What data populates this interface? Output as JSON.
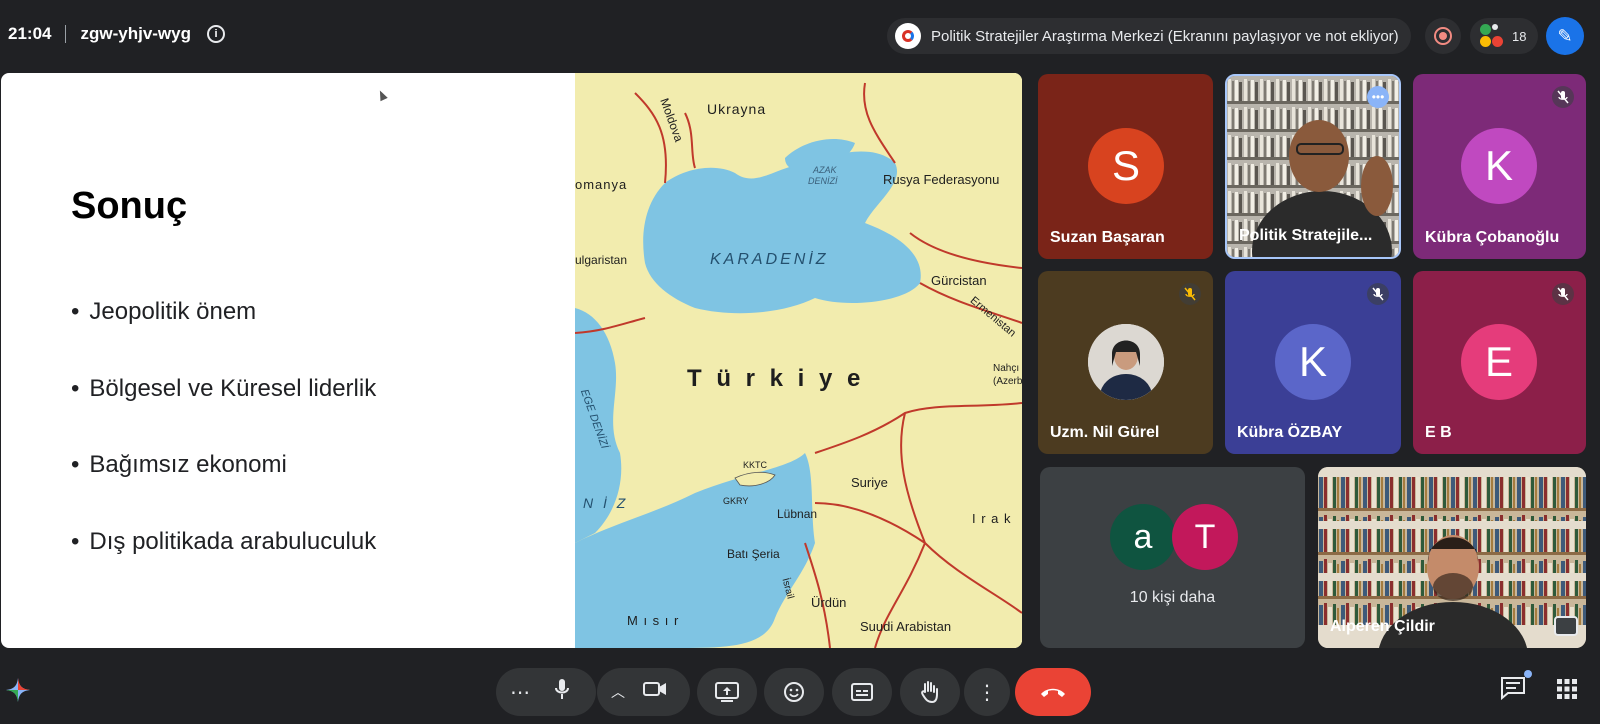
{
  "header": {
    "time": "21:04",
    "meeting_code": "zgw-yhjv-wyg",
    "presenter_status": "Politik Stratejiler Araştırma Merkezi (Ekranını paylaşıyor ve not ekliyor)",
    "participant_count": "18"
  },
  "slide": {
    "title": "Sonuç",
    "bullets": [
      "Jeopolitik önem",
      "Bölgesel ve Küresel liderlik",
      "Bağımsız ekonomi",
      "Dış politikada arabuluculuk"
    ],
    "map_labels": {
      "ukrayna": "Ukrayna",
      "moldova": "Moldova",
      "romanya": "omanya",
      "rusya": "Rusya Federasyonu",
      "azak1": "AZAK",
      "azak2": "DENİZİ",
      "karadeniz": "KARADENİZ",
      "bulgaristan": "ulgaristan",
      "gurcistan": "Gürcistan",
      "ermenistan": "Ermenistan",
      "nahcivan": "Nahçı",
      "azer": "(Azerb",
      "turkiye": "T ü r k i y e",
      "ege": "EGE DENİZİ",
      "kktc": "KKTC",
      "gkry": "GKRY",
      "suriye": "Suriye",
      "irak": "I r a k",
      "lubnan": "Lübnan",
      "bati_seria": "Batı Şeria",
      "israil": "İsrail",
      "urdun": "Ürdün",
      "misir": "M ı s ı r",
      "suudi": "Suudi Arabistan",
      "akdeniz": "N İ Z"
    }
  },
  "participants": [
    {
      "name": "Suzan Başaran",
      "initial": "S"
    },
    {
      "name": "Politik Stratejile..."
    },
    {
      "name": "Kübra Çobanoğlu",
      "initial": "K"
    },
    {
      "name": "Uzm. Nil Gürel"
    },
    {
      "name": "Kübra ÖZBAY",
      "initial": "K"
    },
    {
      "name": "E B",
      "initial": "E"
    },
    {
      "name": "Alperen Çildir"
    }
  ],
  "more": {
    "label": "10 kişi daha",
    "initials": [
      "a",
      "T"
    ]
  },
  "colors": {
    "suzan_bg": "#7a2418",
    "suzan_avatar": "#d8431f",
    "kubra_c_bg": "#7d2a78",
    "kubra_c_avatar": "#c049c0",
    "nil_bg": "#4c3b20",
    "kubra_o_bg": "#3b3f96",
    "kubra_o_avatar": "#5b66c9",
    "eb_bg": "#8c1f49",
    "eb_avatar": "#e53c7b",
    "more_a": "#0f5440",
    "more_t": "#c2185b",
    "sea": "#7fc4e3",
    "land": "#f2ecae",
    "border": "#c0392b"
  }
}
